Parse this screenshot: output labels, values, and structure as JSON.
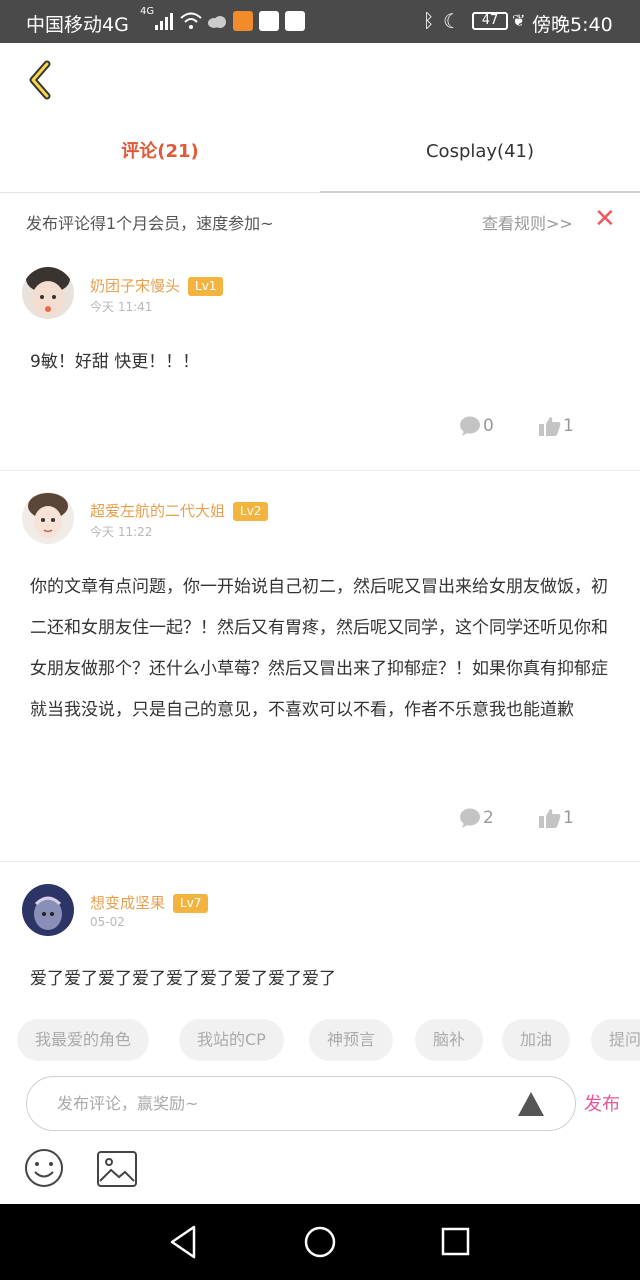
{
  "status_bar": {
    "carrier": "中国移动4G",
    "network_small": "4G",
    "battery": "47",
    "time": "傍晚5:40"
  },
  "tabs": [
    {
      "label": "评论(21)",
      "active": true
    },
    {
      "label": "Cosplay(41)",
      "active": false
    }
  ],
  "notice": {
    "text": "发布评论得1个月会员，速度参加~",
    "rules_link": "查看规则>>"
  },
  "comments": [
    {
      "username": "奶团子宋慢头",
      "level": "Lv1",
      "time": "今天 11:41",
      "text": "9敏！好甜 快更！！！",
      "reply_count": "0",
      "like_count": "1"
    },
    {
      "username": "超爱左航的二代大姐",
      "level": "Lv2",
      "time": "今天 11:22",
      "text": "你的文章有点问题，你一开始说自己初二，然后呢又冒出来给女朋友做饭，初二还和女朋友住一起？！然后又有胃疼，然后呢又同学，这个同学还听见你和女朋友做那个？还什么小草莓？然后又冒出来了抑郁症？！如果你真有抑郁症就当我没说，只是自己的意见，不喜欢可以不看，作者不乐意我也能道歉",
      "reply_count": "2",
      "like_count": "1"
    },
    {
      "username": "想变成坚果",
      "level": "Lv7",
      "time": "05-02",
      "text": "爱了爱了爱了爱了爱了爱了爱了爱了爱了"
    }
  ],
  "quick_chips": [
    "我最爱的角色",
    "我站的CP",
    "神预言",
    "脑补",
    "加油",
    "提问"
  ],
  "composer": {
    "placeholder": "发布评论，赢奖励~",
    "publish_label": "发布"
  },
  "icons": {
    "back": "chevron-left-icon",
    "close": "close-icon",
    "reply": "comment-bubble-icon",
    "like": "thumbs-up-icon",
    "send": "triangle-up-icon",
    "emoji": "smiley-icon",
    "image": "image-icon"
  },
  "colors": {
    "accent": "#e05a3a",
    "username": "#e8a04f",
    "level_badge": "#f3b43f",
    "publish": "#e8559a",
    "close": "#f05a5a"
  }
}
